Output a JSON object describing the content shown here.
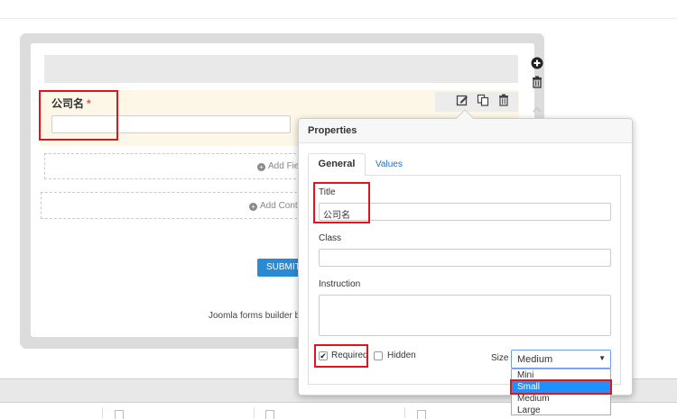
{
  "form": {
    "field_label": "公司名",
    "required_mark": "*",
    "add_field_label": "Add Fie",
    "add_container_label": "Add Conta",
    "submit_label": "SUBMIT",
    "credit": "Joomla forms builder by"
  },
  "properties": {
    "title": "Properties",
    "tabs": {
      "general": "General",
      "values": "Values"
    },
    "title_label": "Title",
    "title_value": "公司名",
    "class_label": "Class",
    "class_value": "",
    "instruction_label": "Instruction",
    "instruction_value": "",
    "required_label": "Required",
    "required_checked": true,
    "hidden_label": "Hidden",
    "hidden_checked": false,
    "size_label": "Size",
    "size_value": "Medium",
    "size_options": [
      "Mini",
      "Small",
      "Medium",
      "Large"
    ],
    "size_highlighted": "Small"
  },
  "icons": {
    "edit": "edit-icon",
    "copy": "copy-icon",
    "delete": "trash-icon",
    "add": "plus-circle-icon",
    "remove": "trash-icon",
    "up": "chevron-up-icon",
    "dropdown": "caret-down-icon"
  },
  "colors": {
    "highlight": "#e0151b",
    "accent": "#2b8ad4",
    "selected_option": "#1e90ff",
    "field_row_bg": "#fcf7e6"
  }
}
